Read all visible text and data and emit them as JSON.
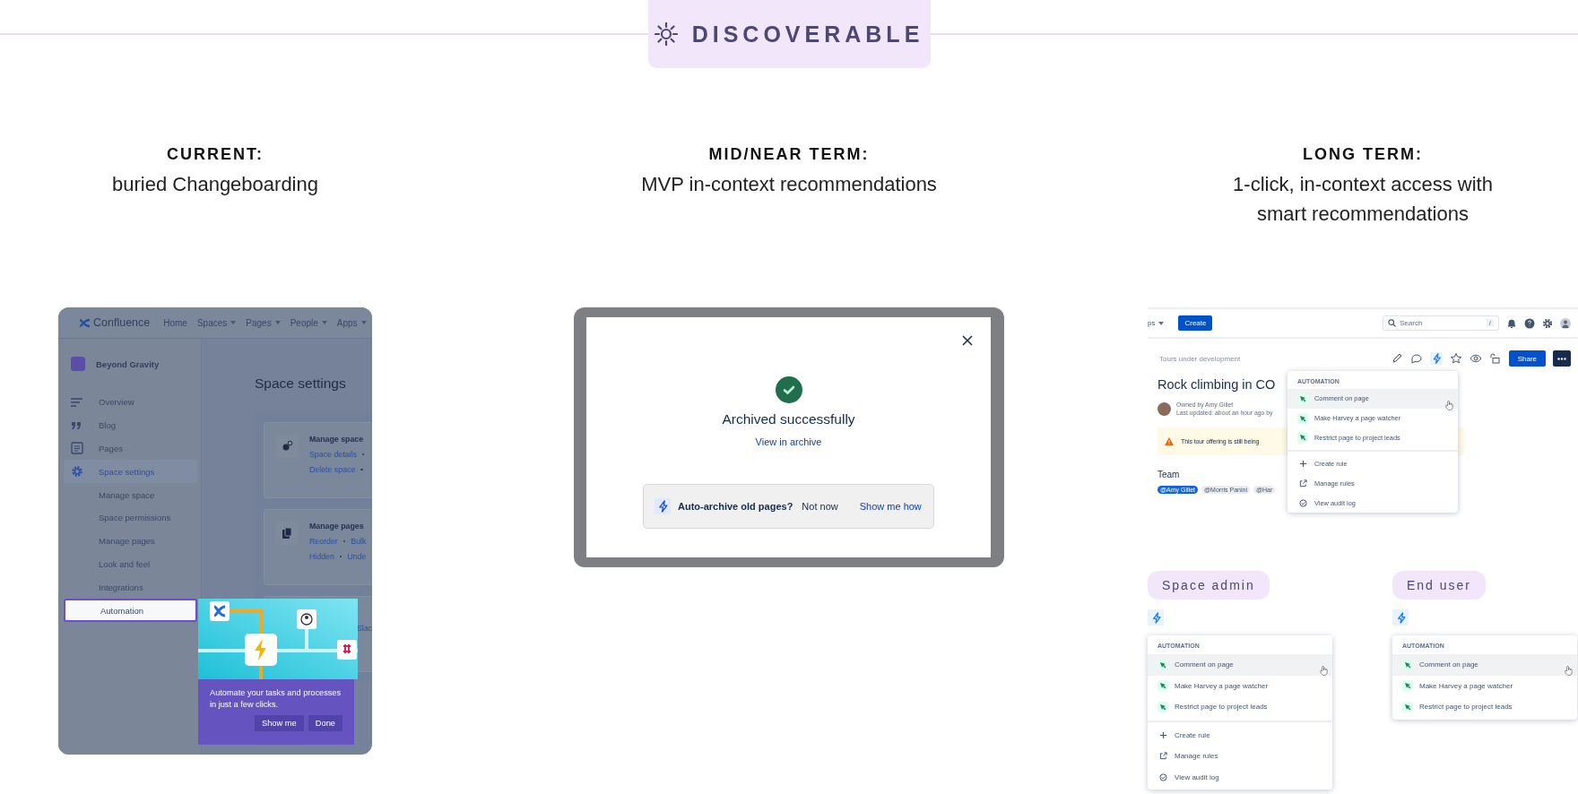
{
  "badge": {
    "label": "DISCOVERABLE"
  },
  "columns": [
    {
      "heading": "CURRENT:",
      "subtitle": "buried Changeboarding"
    },
    {
      "heading": "MID/NEAR TERM:",
      "subtitle": "MVP in-context recommendations"
    },
    {
      "heading": "LONG TERM:",
      "subtitle": "1-click, in-context access with smart recommendations"
    }
  ],
  "current_screen": {
    "nav": {
      "product": "Confluence",
      "items": [
        {
          "label": "Home",
          "dropdown": false
        },
        {
          "label": "Spaces",
          "dropdown": true
        },
        {
          "label": "Pages",
          "dropdown": true
        },
        {
          "label": "People",
          "dropdown": true
        },
        {
          "label": "Apps",
          "dropdown": true
        }
      ]
    },
    "sidebar": {
      "space_name": "Beyond Gravity",
      "items": [
        {
          "label": "Overview",
          "kind": "main",
          "selected": false,
          "spotlit": false
        },
        {
          "label": "Blog",
          "kind": "main",
          "selected": false,
          "spotlit": false
        },
        {
          "label": "Pages",
          "kind": "main",
          "selected": false,
          "spotlit": false
        },
        {
          "label": "Space settings",
          "kind": "main",
          "selected": true,
          "spotlit": false
        },
        {
          "label": "Manage space",
          "kind": "sub",
          "selected": false,
          "spotlit": false
        },
        {
          "label": "Space permissions",
          "kind": "sub",
          "selected": false,
          "spotlit": false
        },
        {
          "label": "Manage pages",
          "kind": "sub",
          "selected": false,
          "spotlit": false
        },
        {
          "label": "Look and feel",
          "kind": "sub",
          "selected": false,
          "spotlit": false
        },
        {
          "label": "Integrations",
          "kind": "sub",
          "selected": false,
          "spotlit": false
        },
        {
          "label": "Automation",
          "kind": "sub",
          "selected": false,
          "spotlit": true
        }
      ]
    },
    "page_title": "Space settings",
    "cards": [
      {
        "title": "Manage space",
        "links": [
          [
            "Space details"
          ],
          [
            "Delete space"
          ]
        ]
      },
      {
        "title": "Manage pages",
        "links": [
          [
            "Reorder",
            "Bulk"
          ],
          [
            "Hidden",
            "Unde"
          ]
        ]
      },
      {
        "links": [
          [
            "Slac"
          ]
        ]
      }
    ],
    "spotlight": {
      "text": "Automate your tasks and processes in just a few clicks.",
      "buttons": [
        "Show me",
        "Done"
      ]
    }
  },
  "mid_screen": {
    "title": "Archived successfully",
    "link": "View in archive",
    "banner": {
      "question": "Auto-archive old pages?",
      "dismiss": "Not now",
      "action": "Show me how"
    }
  },
  "long_term_screen": {
    "nav": {
      "cut_item": "ps",
      "create": "Create",
      "search": {
        "placeholder": "Search",
        "shortcut": "/"
      }
    },
    "breadcrumb": "Tours under development",
    "share": "Share",
    "page_title": "Rock climbing in CO",
    "owner": "Owned by Amy Gillet",
    "updated": "Last updated: about an hour ago by",
    "warning": "This tour offering is still being",
    "team_heading": "Team",
    "mentions": [
      {
        "label": "@Amy Gillet",
        "selected": true
      },
      {
        "label": "@Morris Panini",
        "selected": false
      },
      {
        "label": "@Har",
        "selected": false
      }
    ],
    "menu": {
      "header": "AUTOMATION",
      "rules": [
        {
          "label": "Comment on page",
          "hovered": true
        },
        {
          "label": "Make Harvey a page watcher",
          "hovered": false
        },
        {
          "label": "Restrict page to project leads",
          "hovered": false
        }
      ],
      "actions": [
        {
          "label": "Create rule",
          "kind": "create"
        },
        {
          "label": "Manage rules",
          "kind": "manage"
        },
        {
          "label": "View audit log",
          "kind": "audit"
        }
      ]
    }
  },
  "roles": [
    {
      "label": "Space admin",
      "menu": {
        "header": "AUTOMATION",
        "rules": [
          {
            "label": "Comment on page",
            "hovered": true
          },
          {
            "label": "Make Harvey a page watcher",
            "hovered": false
          },
          {
            "label": "Restrict page to project leads",
            "hovered": false
          }
        ],
        "actions": [
          {
            "label": "Create rule",
            "kind": "create"
          },
          {
            "label": "Manage rules",
            "kind": "manage"
          },
          {
            "label": "View audit log",
            "kind": "audit"
          }
        ]
      }
    },
    {
      "label": "End user",
      "menu": {
        "header": "AUTOMATION",
        "rules": [
          {
            "label": "Comment on page",
            "hovered": true
          },
          {
            "label": "Make Harvey a page watcher",
            "hovered": false
          },
          {
            "label": "Restrict page to project leads",
            "hovered": false
          }
        ]
      }
    }
  ]
}
